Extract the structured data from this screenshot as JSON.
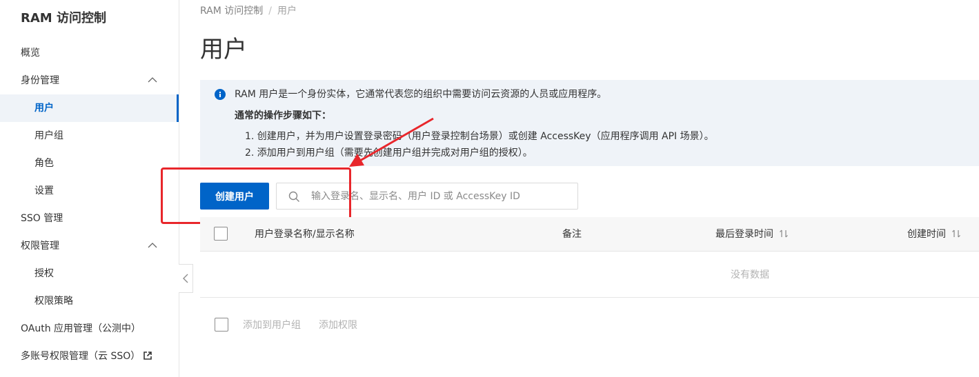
{
  "sidebar": {
    "title": "RAM 访问控制",
    "items": [
      {
        "label": "概览"
      },
      {
        "label": "身份管理"
      },
      {
        "label": "用户"
      },
      {
        "label": "用户组"
      },
      {
        "label": "角色"
      },
      {
        "label": "设置"
      },
      {
        "label": "SSO 管理"
      },
      {
        "label": "权限管理"
      },
      {
        "label": "授权"
      },
      {
        "label": "权限策略"
      },
      {
        "label": "OAuth 应用管理（公测中）"
      },
      {
        "label": "多账号权限管理（云 SSO）"
      }
    ],
    "active_item": "用户"
  },
  "breadcrumb": {
    "root": "RAM 访问控制",
    "separator": "/",
    "current": "用户"
  },
  "page": {
    "title": "用户"
  },
  "notice": {
    "line1": "RAM 用户是一个身份实体，它通常代表您的组织中需要访问云资源的人员或应用程序。",
    "heading": "通常的操作步骤如下：",
    "step1": "1. 创建用户，并为用户设置登录密码（用户登录控制台场景）或创建 AccessKey（应用程序调用 API 场景）。",
    "step2": "2. 添加用户到用户组（需要先创建用户组并完成对用户组的授权）。"
  },
  "toolbar": {
    "create_label": "创建用户",
    "search_placeholder": "输入登录名、显示名、用户 ID 或 AccessKey ID",
    "search_value": ""
  },
  "table": {
    "columns": [
      "用户登录名称/显示名称",
      "备注",
      "最后登录时间",
      "创建时间"
    ],
    "rows": [],
    "empty_text": "没有数据"
  },
  "footer": {
    "add_to_group": "添加到用户组",
    "add_permission": "添加权限"
  },
  "colors": {
    "primary": "#0064c8",
    "annotation": "#e8262b",
    "notice_bg": "#eff3f8"
  }
}
